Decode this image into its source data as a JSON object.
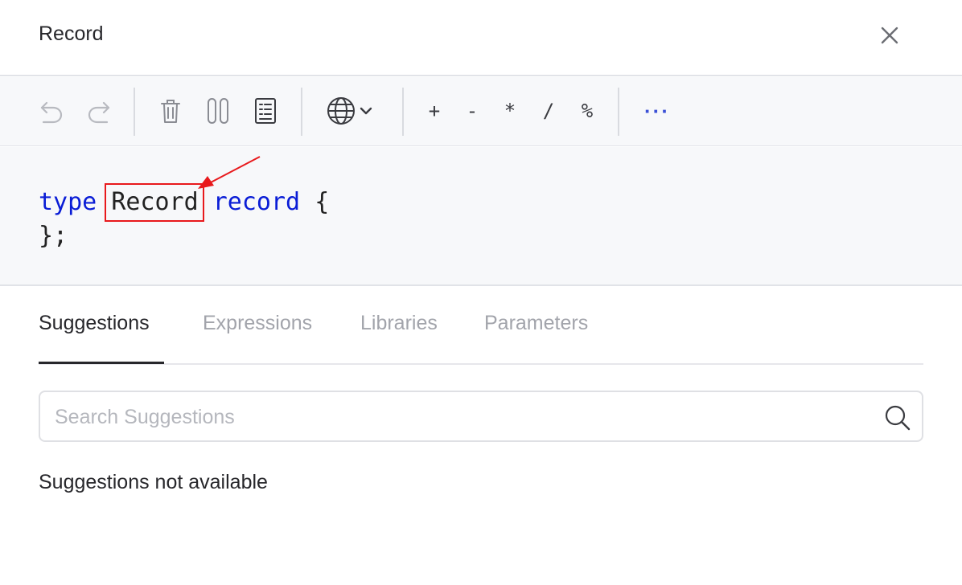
{
  "header": {
    "title": "Record",
    "close_icon": "close-icon"
  },
  "toolbar": {
    "buttons": [
      "undo-icon",
      "redo-icon",
      "delete-icon",
      "pause-icon",
      "format-icon",
      "globe-dropdown-icon"
    ],
    "operators": [
      "+",
      "-",
      "*",
      "/",
      "%"
    ],
    "more": "···"
  },
  "editor": {
    "line1": {
      "keyword": "type",
      "name": "Record",
      "keyword2": "record",
      "brace": "{"
    },
    "line2": "};",
    "colors": {
      "keyword": "#0a1dd6",
      "highlight": "#e8191c"
    }
  },
  "tabs": [
    "Suggestions",
    "Expressions",
    "Libraries",
    "Parameters"
  ],
  "search": {
    "placeholder": "Search Suggestions",
    "value": ""
  },
  "message": "Suggestions not available"
}
